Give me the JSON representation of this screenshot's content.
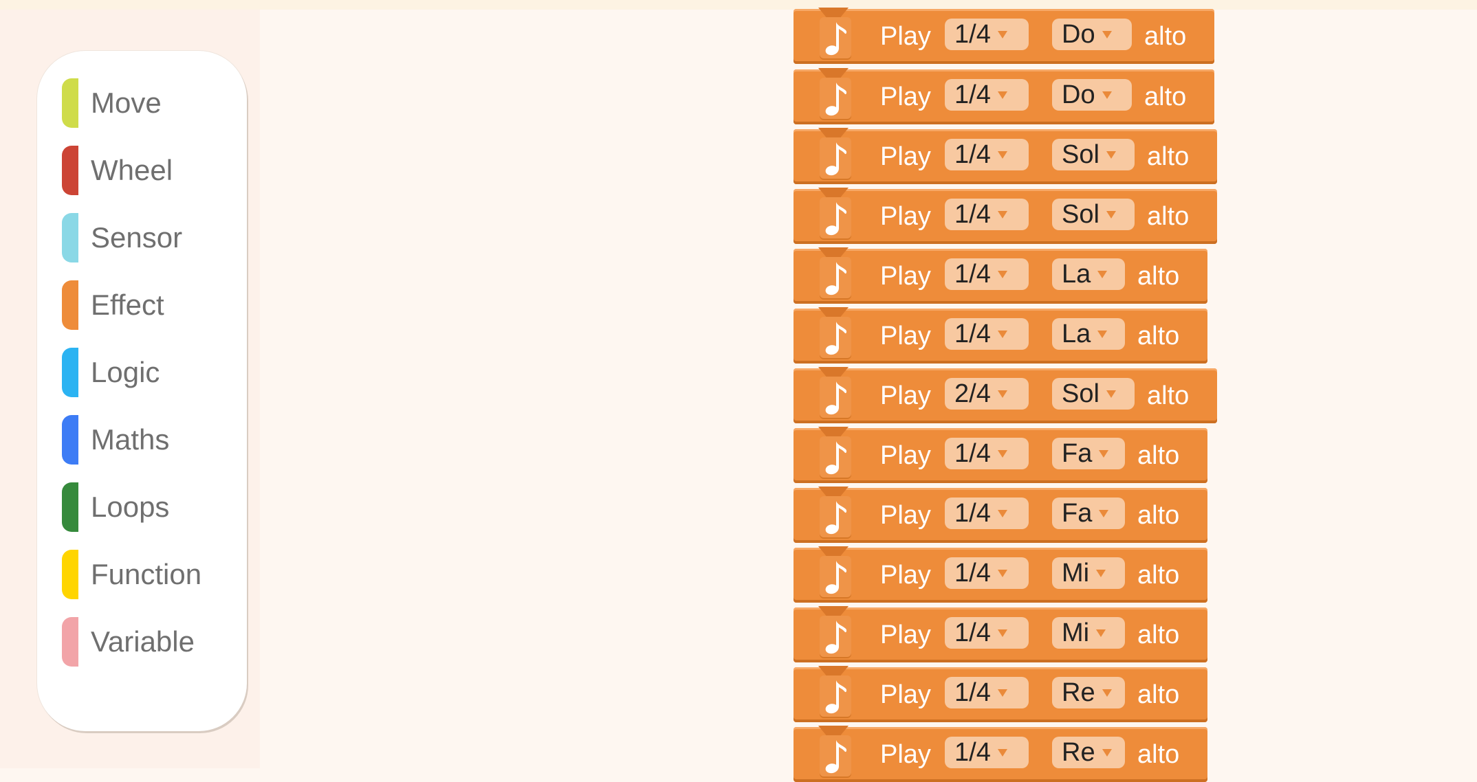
{
  "palette": {
    "categories": [
      {
        "label": "Move",
        "color": "#cfdc4a"
      },
      {
        "label": "Wheel",
        "color": "#cc4435"
      },
      {
        "label": "Sensor",
        "color": "#8ad8e6"
      },
      {
        "label": "Effect",
        "color": "#ee8c3a"
      },
      {
        "label": "Logic",
        "color": "#2bb3f2"
      },
      {
        "label": "Maths",
        "color": "#3d7cf5"
      },
      {
        "label": "Loops",
        "color": "#368a3c"
      },
      {
        "label": "Function",
        "color": "#ffd500"
      },
      {
        "label": "Variable",
        "color": "#f2a4a8"
      }
    ]
  },
  "blocks": [
    {
      "play": "Play",
      "duration": "1/4",
      "note": "Do",
      "octave": "alto"
    },
    {
      "play": "Play",
      "duration": "1/4",
      "note": "Do",
      "octave": "alto"
    },
    {
      "play": "Play",
      "duration": "1/4",
      "note": "Sol",
      "octave": "alto"
    },
    {
      "play": "Play",
      "duration": "1/4",
      "note": "Sol",
      "octave": "alto"
    },
    {
      "play": "Play",
      "duration": "1/4",
      "note": "La",
      "octave": "alto"
    },
    {
      "play": "Play",
      "duration": "1/4",
      "note": "La",
      "octave": "alto"
    },
    {
      "play": "Play",
      "duration": "2/4",
      "note": "Sol",
      "octave": "alto"
    },
    {
      "play": "Play",
      "duration": "1/4",
      "note": "Fa",
      "octave": "alto"
    },
    {
      "play": "Play",
      "duration": "1/4",
      "note": "Fa",
      "octave": "alto"
    },
    {
      "play": "Play",
      "duration": "1/4",
      "note": "Mi",
      "octave": "alto"
    },
    {
      "play": "Play",
      "duration": "1/4",
      "note": "Mi",
      "octave": "alto"
    },
    {
      "play": "Play",
      "duration": "1/4",
      "note": "Re",
      "octave": "alto"
    },
    {
      "play": "Play",
      "duration": "1/4",
      "note": "Re",
      "octave": "alto"
    }
  ],
  "icons": {
    "block_icon": "music-note-icon",
    "dropdown_icon": "dropdown-arrow-icon"
  },
  "colors": {
    "effect_block": "#ee8c3a",
    "dropdown_field": "#f8c9a1"
  }
}
